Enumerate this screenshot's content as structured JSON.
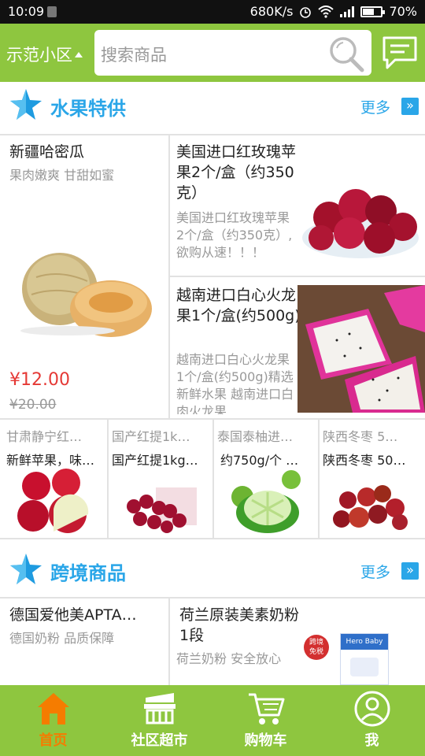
{
  "status_bar": {
    "time": "10:09",
    "network_speed": "680K/s",
    "battery": "70%",
    "battery_level": 0.7
  },
  "header": {
    "district": "示范小区",
    "search_placeholder": "搜索商品"
  },
  "section_fruit": {
    "title": "水果特供",
    "more": "更多"
  },
  "fruit_feature": {
    "name": "新疆哈密瓜",
    "desc": "果肉嫩爽 甘甜如蜜",
    "price": "¥12.00",
    "old_price": "¥20.00"
  },
  "fruit_items": [
    {
      "name": "美国进口红玫瑰苹果2个/盒（约350克）",
      "desc": "美国进口红玫瑰苹果2个/盒（约350克）,欲购从速！！！"
    },
    {
      "name": "越南进口白心火龙果1个/盒(约500g)",
      "desc": "越南进口白心火龙果1个/盒(约500g)精选新鲜水果 越南进口白肉火龙果"
    }
  ],
  "small_items": [
    {
      "title": "甘肃静宁红…",
      "subtitle": "新鲜苹果，味…"
    },
    {
      "title": "国产红提1k…",
      "subtitle": "国产红提1kg…"
    },
    {
      "title": "泰国泰柚进…",
      "subtitle": "约750g/个 …"
    },
    {
      "title": "陕西冬枣 5…",
      "subtitle": "陕西冬枣 50…"
    }
  ],
  "section_cross": {
    "title": "跨境商品",
    "more": "更多"
  },
  "cross_items": [
    {
      "name": "德国爱他美APTA…",
      "desc": "德国奶粉 品质保障"
    },
    {
      "name": "荷兰原装美素奶粉1段",
      "desc": "荷兰奶粉 安全放心",
      "badge_line1": "跨境",
      "badge_line2": "免税",
      "brand": "Hero Baby"
    }
  ],
  "tabs": [
    {
      "label": "首页",
      "icon": "home-icon",
      "active": true
    },
    {
      "label": "社区超市",
      "icon": "store-icon",
      "active": false
    },
    {
      "label": "购物车",
      "icon": "cart-icon",
      "active": false
    },
    {
      "label": "我",
      "icon": "profile-icon",
      "active": false
    }
  ],
  "colors": {
    "brand_green": "#8ec63f",
    "accent_blue": "#2aa6e8",
    "price_red": "#e53935",
    "active_tab": "#f57c00"
  }
}
